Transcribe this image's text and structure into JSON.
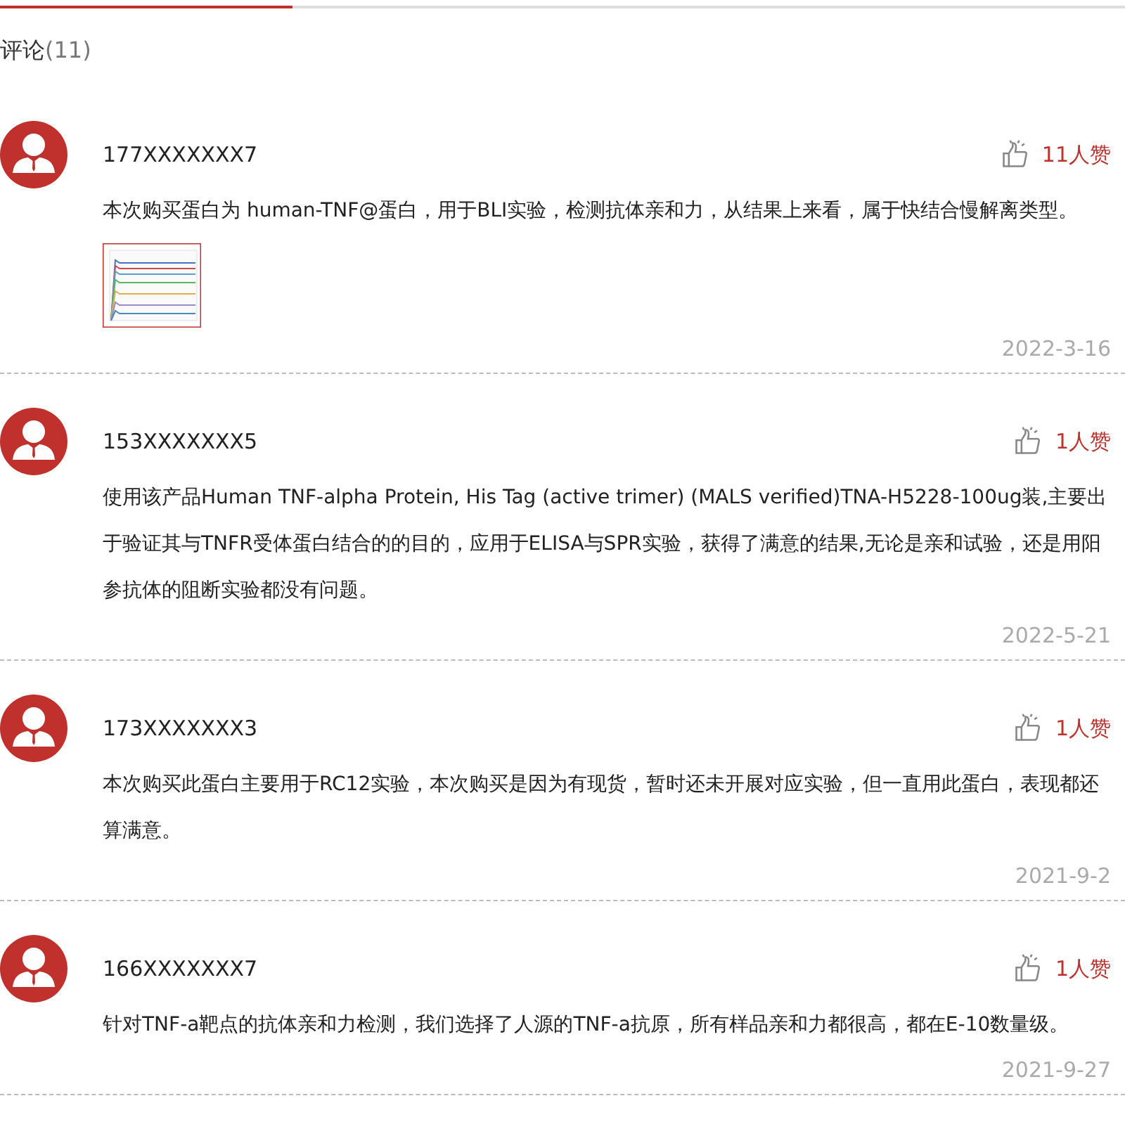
{
  "section": {
    "title": "评论",
    "count": "(11)"
  },
  "comments": [
    {
      "user": "177XXXXXXX7",
      "likes": "11人赞",
      "text": "本次购买蛋白为 human-TNF@蛋白，用于BLI实验，检测抗体亲和力，从结果上来看，属于快结合慢解离类型。",
      "date": "2022-3-16"
    },
    {
      "user": "153XXXXXXX5",
      "likes": "1人赞",
      "text": "使用该产品Human TNF-alpha Protein, His Tag (active trimer) (MALS verified)TNA-H5228-100ug装,主要出于验证其与TNFR受体蛋白结合的的目的，应用于ELISA与SPR实验，获得了满意的结果,无论是亲和试验，还是用阳参抗体的阻断实验都没有问题。",
      "date": "2022-5-21"
    },
    {
      "user": "173XXXXXXX3",
      "likes": "1人赞",
      "text": "本次购买此蛋白主要用于RC12实验，本次购买是因为有现货，暂时还未开展对应实验，但一直用此蛋白，表现都还算满意。",
      "date": "2021-9-2"
    },
    {
      "user": "166XXXXXXX7",
      "likes": "1人赞",
      "text": "针对TNF-a靶点的抗体亲和力检测，我们选择了人源的TNF-a抗原，所有样品亲和力都很高，都在E-10数量级。",
      "date": "2021-9-27"
    }
  ]
}
